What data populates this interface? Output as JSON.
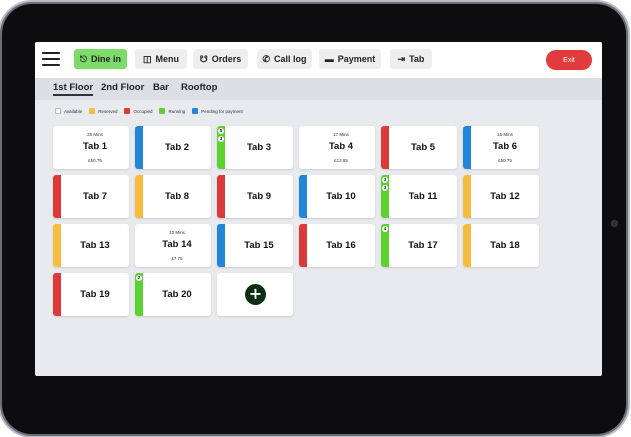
{
  "nav": {
    "dine_in": "Dine in",
    "menu": "Menu",
    "orders": "Orders",
    "call_log": "Call log",
    "payment": "Payment",
    "tab": "Tab",
    "exit": "Exit"
  },
  "floors": [
    "1st Floor",
    "2nd Floor",
    "Bar",
    "Rooftop"
  ],
  "active_floor": "1st Floor",
  "legend": [
    {
      "label": "Available",
      "color": "#ffffff"
    },
    {
      "label": "Reserved",
      "color": "#f6bd41"
    },
    {
      "label": "Occupied",
      "color": "#dc3a3a"
    },
    {
      "label": "Running",
      "color": "#5bd22f"
    },
    {
      "label": "Pending for payment",
      "color": "#2385d8"
    }
  ],
  "status_colors": {
    "available": "#ffffff",
    "reserved": "#f6bd41",
    "occupied": "#dc3a3a",
    "running": "#5bd22f",
    "pending": "#2385d8"
  },
  "tables": [
    {
      "name": "Tab 1",
      "status": "available",
      "mins": "25 Mins",
      "amount": "£50.75"
    },
    {
      "name": "Tab 2",
      "status": "pending"
    },
    {
      "name": "Tab 3",
      "status": "running",
      "badges": [
        "5",
        "3"
      ]
    },
    {
      "name": "Tab 4",
      "status": "available",
      "mins": "17 Mins",
      "amount": "£13.85"
    },
    {
      "name": "Tab 5",
      "status": "occupied"
    },
    {
      "name": "Tab 6",
      "status": "pending",
      "mins": "15 Mins",
      "amount": "£50.75"
    },
    {
      "name": "Tab 7",
      "status": "occupied"
    },
    {
      "name": "Tab 8",
      "status": "reserved"
    },
    {
      "name": "Tab 9",
      "status": "occupied"
    },
    {
      "name": "Tab 10",
      "status": "pending"
    },
    {
      "name": "Tab 11",
      "status": "running",
      "badges": [
        "3",
        "3"
      ]
    },
    {
      "name": "Tab 12",
      "status": "reserved"
    },
    {
      "name": "Tab 13",
      "status": "reserved"
    },
    {
      "name": "Tab 14",
      "status": "available",
      "mins": "10 Mins",
      "amount": "£7.75"
    },
    {
      "name": "Tab 15",
      "status": "pending"
    },
    {
      "name": "Tab 16",
      "status": "occupied"
    },
    {
      "name": "Tab 17",
      "status": "running",
      "badges": [
        "4"
      ]
    },
    {
      "name": "Tab 18",
      "status": "reserved"
    },
    {
      "name": "Tab 19",
      "status": "occupied"
    },
    {
      "name": "Tab 20",
      "status": "running",
      "badges": [
        "2"
      ]
    }
  ],
  "add_table_icon": "plus-icon"
}
